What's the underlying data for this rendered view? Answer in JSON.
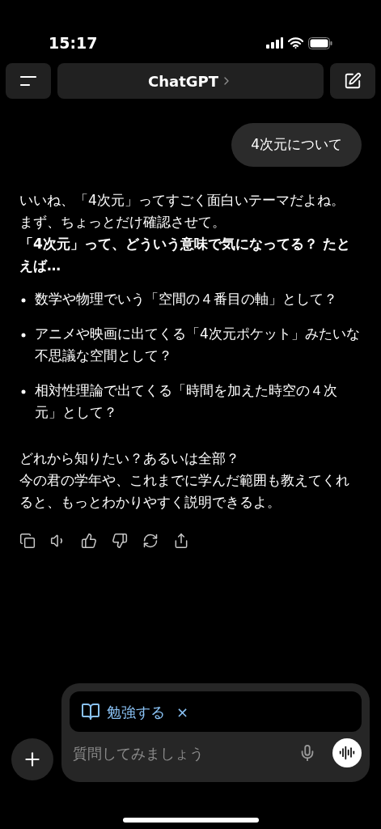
{
  "status_bar": {
    "time": "15:17"
  },
  "header": {
    "title": "ChatGPT"
  },
  "user_message": "4次元について",
  "reply": {
    "paragraphs": [
      {
        "text": "いいね、「4次元」ってすごく面白いテーマだよね。",
        "bold": false
      },
      {
        "text": "まず、ちょっとだけ確認させて。",
        "bold": false
      },
      {
        "text": "「4次元」って、どういう意味で気になってる？ たとえば…",
        "bold": true
      }
    ],
    "bullets": [
      "数学や物理でいう「空間の４番目の軸」として？",
      "アニメや映画に出てくる「4次元ポケット」みたいな不思議な空間として？",
      "相対性理論で出てくる「時間を加えた時空の４次元」として？"
    ],
    "closing": [
      "どれから知りたい？あるいは全部？",
      "今の君の学年や、これまでに学んだ範囲も教えてくれると、もっとわかりやすく説明できるよ。"
    ]
  },
  "composer": {
    "tool_chip": {
      "label": "勉強する",
      "close": "×"
    },
    "placeholder": "質問してみましょう"
  }
}
